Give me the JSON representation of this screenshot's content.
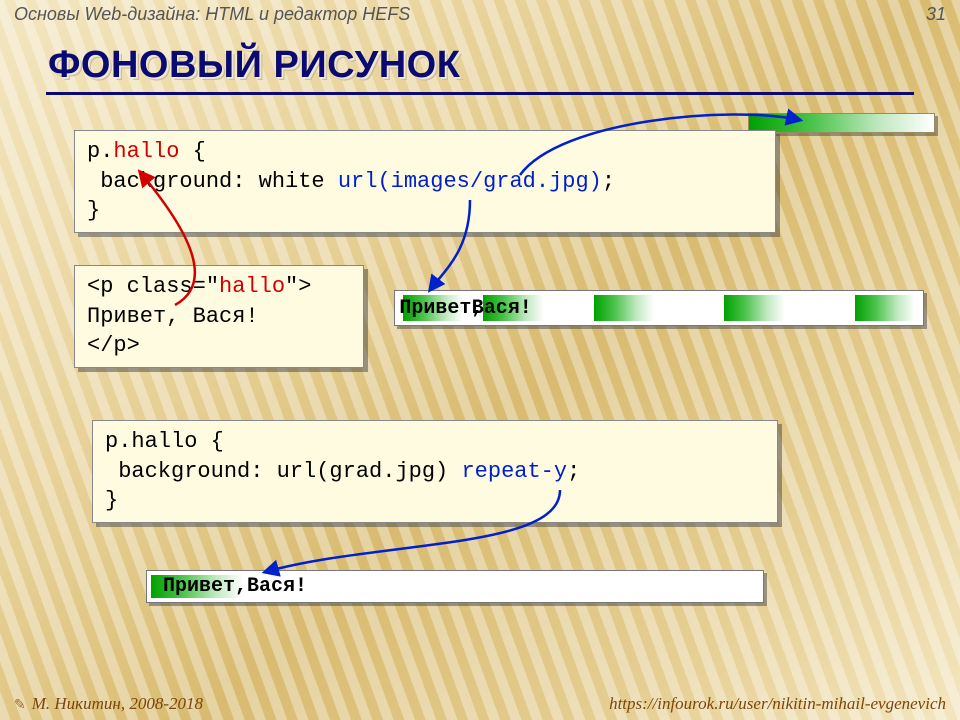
{
  "header": {
    "title": "Основы Web-дизайна: HTML и редактор HEFS",
    "page_no": "31"
  },
  "slide": {
    "title": "ФОНОВЫЙ РИСУНОК"
  },
  "code1": {
    "l1a": "p.",
    "hallo": "hallo",
    "l1b": " {",
    "l2a": " background: white ",
    "url": "url(images/grad.jpg)",
    "l2b": ";",
    "l3": "}"
  },
  "code2": {
    "l1": "<p class=\"",
    "hallo": "hallo",
    "l1b": "\">",
    "l2": "Привет, Вася!",
    "l3": "</p>"
  },
  "sample1": {
    "word1": "Привет, ",
    "word2": "Вася!"
  },
  "code3": {
    "l1": "p.hallo {",
    "l2a": " background: url(grad.jpg) ",
    "repeat": "repeat-y",
    "l2b": ";",
    "l3": "}"
  },
  "sample2": {
    "word1": "Привет, ",
    "word2": "Вася!"
  },
  "footer": {
    "author": "М. Никитин, 2008-2018",
    "url": "https://infourok.ru/user/nikitin-mihail-evgenevich"
  }
}
